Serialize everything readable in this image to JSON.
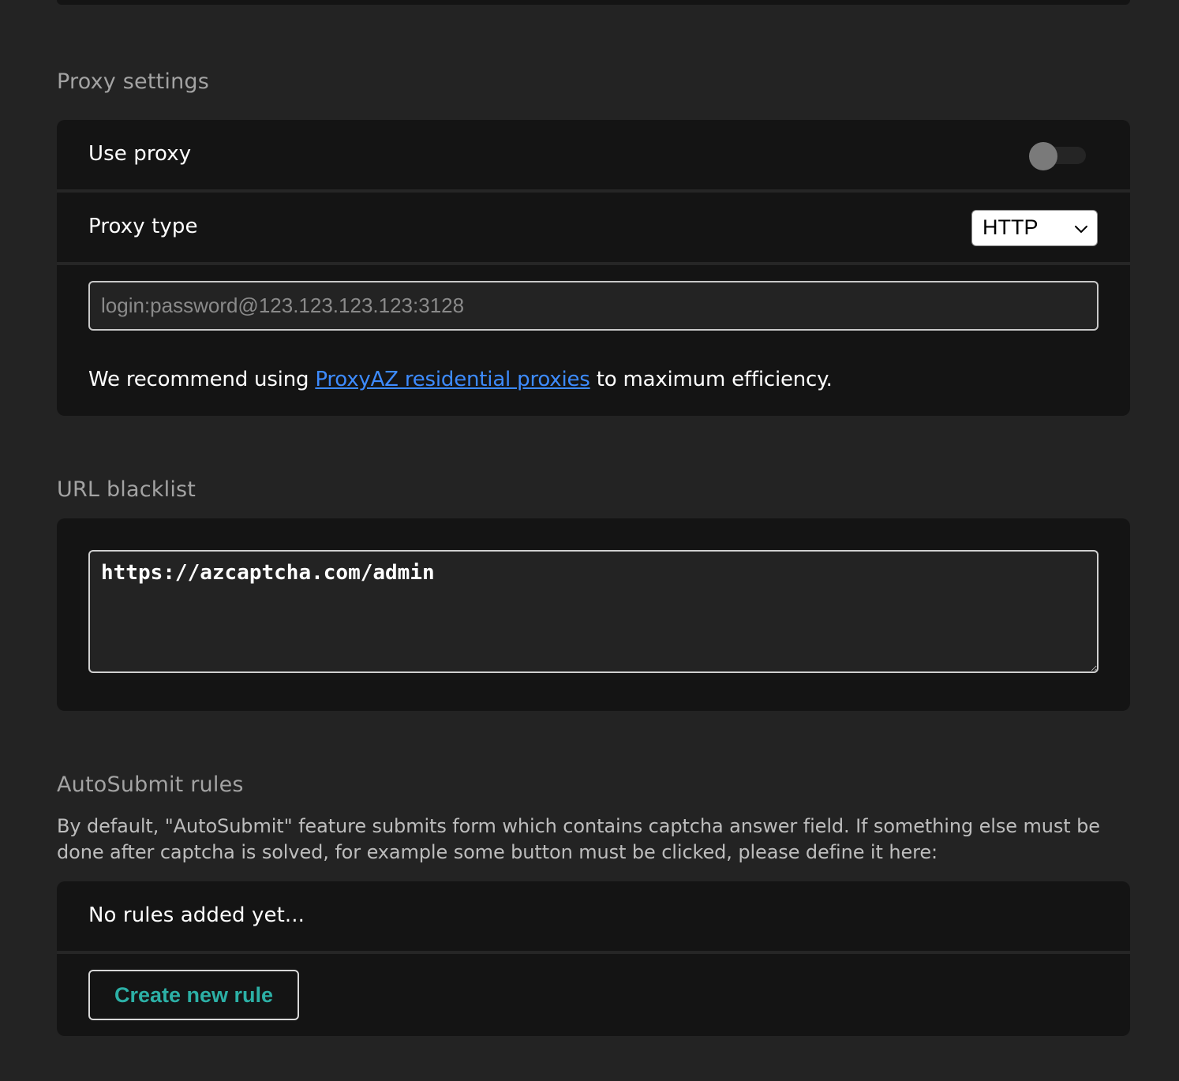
{
  "proxy": {
    "title": "Proxy settings",
    "use_proxy_label": "Use proxy",
    "use_proxy_enabled": false,
    "proxy_type_label": "Proxy type",
    "proxy_type_value": "HTTP",
    "proxy_input_value": "",
    "proxy_input_placeholder": "login:password@123.123.123.123:3128",
    "recommend_prefix": "We recommend using ",
    "recommend_link": "ProxyAZ residential proxies",
    "recommend_suffix": " to maximum efficiency."
  },
  "blacklist": {
    "title": "URL blacklist",
    "textarea_value": "https://azcaptcha.com/admin"
  },
  "autosubmit": {
    "title": "AutoSubmit rules",
    "description": "By default, \"AutoSubmit\" feature submits form which contains captcha answer field. If something else must be done after captcha is solved, for example some button must be clicked, please define it here:",
    "empty_text": "No rules added yet...",
    "create_button_label": "Create new rule"
  },
  "colors": {
    "background": "#232323",
    "panel": "#141414",
    "link": "#3d8bff",
    "accent_button_text": "#2cb0a6"
  }
}
